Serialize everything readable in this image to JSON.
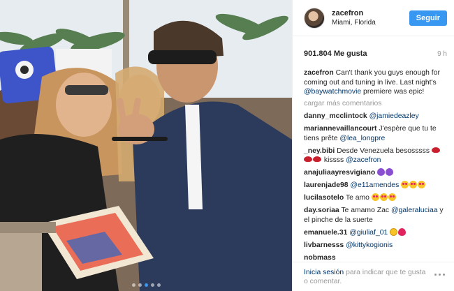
{
  "post": {
    "username": "zacefron",
    "location": "Miami, Florida",
    "follow_label": "Seguir",
    "likes": "901.804 Me gusta",
    "time": "9 h"
  },
  "caption": {
    "user": "zacefron",
    "text_before": "Can't thank you guys enough for coming out and tuning in live. Last night's ",
    "mention": "@baywatchmovie",
    "text_after": " premiere was epic!"
  },
  "load_more": "cargar más comentarios",
  "comments": [
    {
      "user": "danny_mcclintock",
      "text": "",
      "mention": "@jamiedeazley",
      "emojis": []
    },
    {
      "user": "mariannevaillancourt",
      "text": "J'espère que tu te tiens prête ",
      "mention": "@lea_longpre",
      "emojis": []
    },
    {
      "user": "_ney.bibi",
      "text": "Desde Venezuela besosssss",
      "mention": "",
      "emojis": [
        "lips"
      ],
      "text2": " kissss ",
      "mention2": "@zacefron",
      "emojis2": [
        "lips",
        "lips"
      ]
    },
    {
      "user": "anajuliaayresvigiano",
      "text": "",
      "mention": "",
      "emojis": [
        "purple-heart",
        "purple-heart"
      ]
    },
    {
      "user": "laurenjade98",
      "text": "",
      "mention": "@e11amendes",
      "emojis": [
        "heart-eyes",
        "heart-eyes",
        "heart-eyes"
      ]
    },
    {
      "user": "lucilasotelo",
      "text": "Te amo",
      "mention": "",
      "emojis": [
        "heart-eyes",
        "heart-eyes",
        "heart-eyes"
      ]
    },
    {
      "user": "day.soriaa",
      "text": "Te amamo Zac ",
      "mention": "@galeraluciaa",
      "text_after": " y el pinche de la suerte",
      "emojis": []
    },
    {
      "user": "emanuele.31",
      "text": "",
      "mention": "@giuliaf_01",
      "emojis": [
        "smile",
        "red-heart"
      ]
    },
    {
      "user": "livbarnesss",
      "text": "",
      "mention": "@kittykogionis",
      "emojis": []
    },
    {
      "user": "nobmass",
      "text": "",
      "mention": "",
      "emojis": []
    }
  ],
  "footer": {
    "login_link": "Inicia sesión",
    "rest": " para indicar que te gusta o comentar."
  },
  "icons": {
    "more": "more-options-icon",
    "avatar": "profile-avatar"
  },
  "colors": {
    "accent": "#3897f0",
    "link": "#003569",
    "muted": "#999999"
  }
}
